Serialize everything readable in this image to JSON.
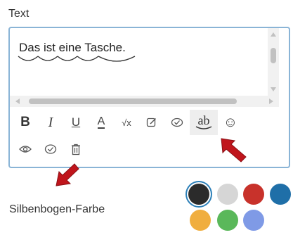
{
  "section_label": "Text",
  "editor": {
    "content": "Das ist eine Tasche."
  },
  "toolbar": {
    "row1": [
      {
        "name": "bold-button",
        "glyph": "B"
      },
      {
        "name": "italic-button",
        "glyph": "I"
      },
      {
        "name": "underline-button",
        "glyph": "U"
      },
      {
        "name": "text-color-button",
        "glyph": "A"
      },
      {
        "name": "formula-button",
        "glyph": "√x"
      },
      {
        "name": "edit-button",
        "glyph": "✎"
      },
      {
        "name": "check-button",
        "glyph": "✓"
      },
      {
        "name": "syllable-arc-button",
        "glyph": "ab"
      },
      {
        "name": "emoji-button",
        "glyph": "☺"
      }
    ],
    "row2": [
      {
        "name": "preview-button",
        "icon": "eye-icon"
      },
      {
        "name": "check-circle-button",
        "icon": "check-circle-icon"
      },
      {
        "name": "delete-button",
        "icon": "trash-icon"
      }
    ]
  },
  "colors": {
    "label": "Silbenbogen-Farbe",
    "swatches": [
      {
        "name": "black",
        "hex": "#2b2b2b",
        "selected": true
      },
      {
        "name": "light-gray",
        "hex": "#d6d6d6"
      },
      {
        "name": "red",
        "hex": "#c8322b"
      },
      {
        "name": "blue",
        "hex": "#1f6fa8"
      },
      {
        "name": "orange",
        "hex": "#f0ae3f"
      },
      {
        "name": "green",
        "hex": "#5ab85a"
      },
      {
        "name": "periwinkle",
        "hex": "#7f9ae6"
      }
    ]
  },
  "accent": "#8ab4d6",
  "annotation_color": "#c0151c"
}
